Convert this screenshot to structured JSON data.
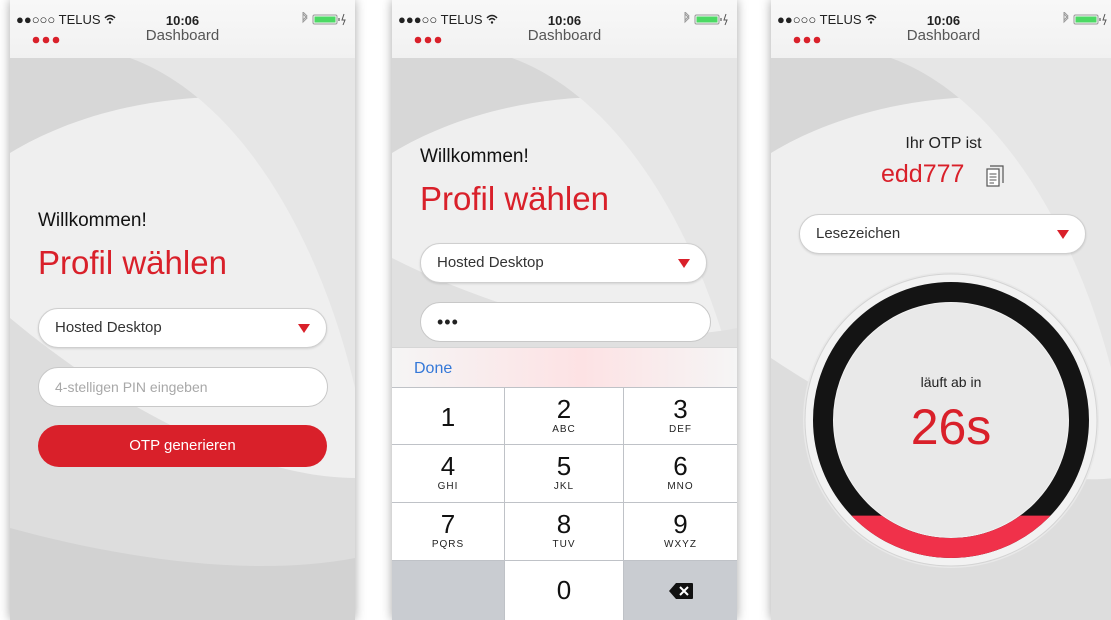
{
  "status_bar": {
    "carrier": "●●○○○ TELUS",
    "carrier_2": "●●●○○ TELUS",
    "time": "10:06",
    "title": "Dashboard"
  },
  "screen_login": {
    "welcome": "Willkommen!",
    "heading": "Profil wählen",
    "profile_selected": "Hosted Desktop",
    "pin_placeholder": "4-stelligen PIN eingeben",
    "generate_button": "OTP generieren"
  },
  "screen_keypad": {
    "welcome": "Willkommen!",
    "heading": "Profil wählen",
    "profile_selected": "Hosted Desktop",
    "pin_value": "•••",
    "done_label": "Done",
    "keys": [
      {
        "num": "1",
        "letters": ""
      },
      {
        "num": "2",
        "letters": "ABC"
      },
      {
        "num": "3",
        "letters": "DEF"
      },
      {
        "num": "4",
        "letters": "GHI"
      },
      {
        "num": "5",
        "letters": "JKL"
      },
      {
        "num": "6",
        "letters": "MNO"
      },
      {
        "num": "7",
        "letters": "PQRS"
      },
      {
        "num": "8",
        "letters": "TUV"
      },
      {
        "num": "9",
        "letters": "WXYZ"
      },
      {
        "num": "0",
        "letters": ""
      }
    ]
  },
  "screen_otp": {
    "otp_label": "Ihr OTP ist",
    "otp_value": "edd777",
    "bookmark_selected": "Lesezeichen",
    "expires_label": "läuft ab in",
    "expires_value": "26s",
    "remaining_fraction": 0.15
  },
  "colors": {
    "accent": "#d9202a",
    "link": "#3478d8",
    "battery": "#4cd964"
  },
  "icons": [
    "wifi-icon",
    "bluetooth-icon",
    "battery-icon",
    "menu-dots-icon",
    "dropdown-caret-icon",
    "copy-icon",
    "backspace-icon"
  ]
}
